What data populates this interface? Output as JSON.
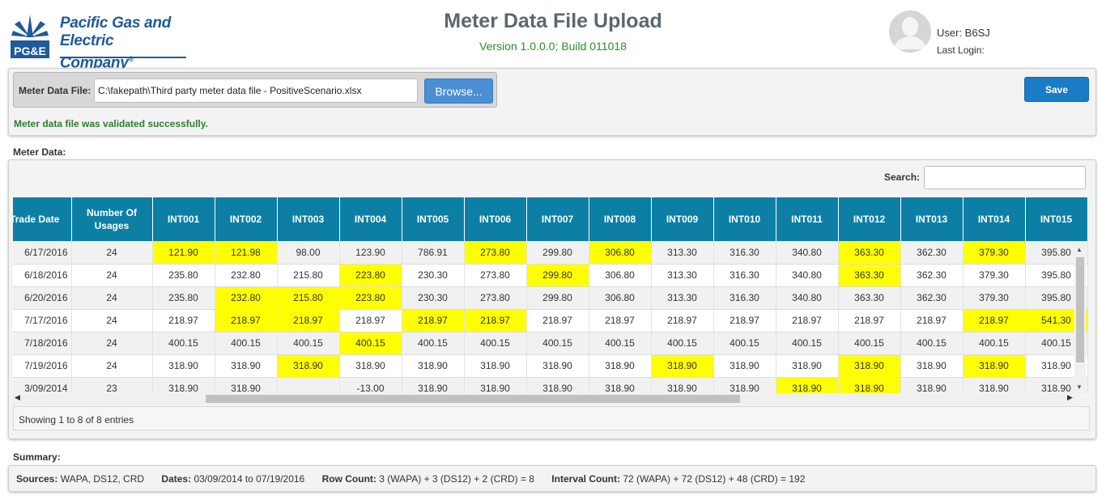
{
  "header": {
    "company_line1": "Pacific Gas and",
    "company_line2": "Electric Company",
    "registered_mark": "®",
    "logo_mark": "PG&E",
    "title": "Meter Data File Upload",
    "version": "Version 1.0.0.0; Build 011018",
    "user_label": "User: B6SJ",
    "last_login_label": "Last Login:"
  },
  "upload": {
    "file_label": "Meter Data File:",
    "file_value": "C:\\fakepath\\Third party meter data file - PositiveScenario.xlsx",
    "browse_label": "Browse...",
    "save_label": "Save",
    "status_message": "Meter data file was validated successfully.",
    "status_color": "#2e7d2e"
  },
  "meter_data": {
    "section_label": "Meter Data:",
    "search_label": "Search:",
    "search_value": "",
    "columns": [
      "Trade Date",
      "Number Of Usages",
      "INT001",
      "INT002",
      "INT003",
      "INT004",
      "INT005",
      "INT006",
      "INT007",
      "INT008",
      "INT009",
      "INT010",
      "INT011",
      "INT012",
      "INT013",
      "INT014",
      "INT015"
    ],
    "highlight_color": "#ffff00",
    "header_color": "#0d7fa5",
    "rows": [
      {
        "cells": [
          "6/17/2016",
          "24",
          "121.90",
          "121.98",
          "98.00",
          "123.90",
          "786.91",
          "273.80",
          "299.80",
          "306.80",
          "313.30",
          "316.30",
          "340.80",
          "363.30",
          "362.30",
          "379.30",
          "395.80"
        ],
        "highlighted": [
          2,
          3,
          7,
          9,
          13,
          15
        ]
      },
      {
        "cells": [
          "6/18/2016",
          "24",
          "235.80",
          "232.80",
          "215.80",
          "223.80",
          "230.30",
          "273.80",
          "299.80",
          "306.80",
          "313.30",
          "316.30",
          "340.80",
          "363.30",
          "362.30",
          "379.30",
          "395.80"
        ],
        "highlighted": [
          5,
          8,
          13
        ]
      },
      {
        "cells": [
          "6/20/2016",
          "24",
          "235.80",
          "232.80",
          "215.80",
          "223.80",
          "230.30",
          "273.80",
          "299.80",
          "306.80",
          "313.30",
          "316.30",
          "340.80",
          "363.30",
          "362.30",
          "379.30",
          "395.80"
        ],
        "highlighted": [
          3,
          4,
          5
        ]
      },
      {
        "cells": [
          "7/17/2016",
          "24",
          "218.97",
          "218.97",
          "218.97",
          "218.97",
          "218.97",
          "218.97",
          "218.97",
          "218.97",
          "218.97",
          "218.97",
          "218.97",
          "218.97",
          "218.97",
          "218.97",
          "541.30"
        ],
        "highlighted": [
          3,
          4,
          6,
          7,
          15,
          16
        ]
      },
      {
        "cells": [
          "7/18/2016",
          "24",
          "400.15",
          "400.15",
          "400.15",
          "400.15",
          "400.15",
          "400.15",
          "400.15",
          "400.15",
          "400.15",
          "400.15",
          "400.15",
          "400.15",
          "400.15",
          "400.15",
          "400.15"
        ],
        "highlighted": [
          5
        ]
      },
      {
        "cells": [
          "7/19/2016",
          "24",
          "318.90",
          "318.90",
          "318.90",
          "318.90",
          "318.90",
          "318.90",
          "318.90",
          "318.90",
          "318.90",
          "318.90",
          "318.90",
          "318.90",
          "318.90",
          "318.90",
          "318.90"
        ],
        "highlighted": [
          4,
          10,
          13,
          15
        ]
      },
      {
        "cells": [
          "3/09/2014",
          "23",
          "318.90",
          "318.90",
          "",
          "-13.00",
          "318.90",
          "318.90",
          "318.90",
          "318.90",
          "318.90",
          "318.90",
          "318.90",
          "318.90",
          "318.90",
          "318.90",
          "318.90"
        ],
        "highlighted": [
          12,
          13
        ]
      }
    ],
    "info_text": "Showing 1 to 8 of 8 entries"
  },
  "summary": {
    "section_label": "Summary:",
    "sources_label": "Sources:",
    "sources_value": "WAPA, DS12, CRD",
    "dates_label": "Dates:",
    "dates_value": "03/09/2014 to 07/19/2016",
    "row_count_label": "Row Count:",
    "row_count_value": "3 (WAPA) + 3 (DS12) + 2 (CRD) = 8",
    "interval_count_label": "Interval Count:",
    "interval_count_value": "72 (WAPA) + 72 (DS12) + 48 (CRD) = 192"
  }
}
